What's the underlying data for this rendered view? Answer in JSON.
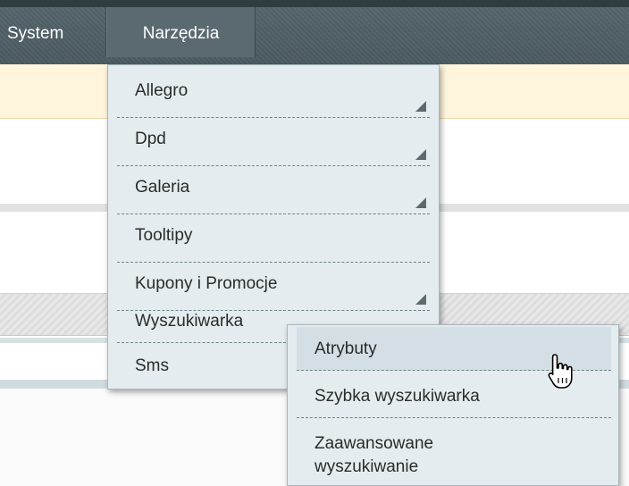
{
  "nav": {
    "items": [
      {
        "label": "System"
      },
      {
        "label": "Narzędzia"
      }
    ]
  },
  "dropdown": {
    "items": [
      {
        "label": "Allegro",
        "has_submenu": true
      },
      {
        "label": "Dpd",
        "has_submenu": true
      },
      {
        "label": "Galeria",
        "has_submenu": true
      },
      {
        "label": "Tooltipy",
        "has_submenu": false
      },
      {
        "label": "Kupony i Promocje",
        "has_submenu": true
      },
      {
        "label": "Wyszukiwarka",
        "has_submenu": true
      },
      {
        "label": "Sms",
        "has_submenu": false
      }
    ]
  },
  "submenu": {
    "items": [
      {
        "label": "Atrybuty"
      },
      {
        "label": "Szybka wyszukiwarka"
      },
      {
        "label_line1": "Zaawansowane",
        "label_line2": "wyszukiwanie"
      }
    ]
  },
  "colors": {
    "nav_bg": "#4b5a61",
    "menu_bg": "#e4ecef",
    "notice_bg": "#fef5dc"
  },
  "icons": {
    "submenu_indicator": "corner-triangle-icon",
    "cursor": "hand-pointer-icon"
  }
}
